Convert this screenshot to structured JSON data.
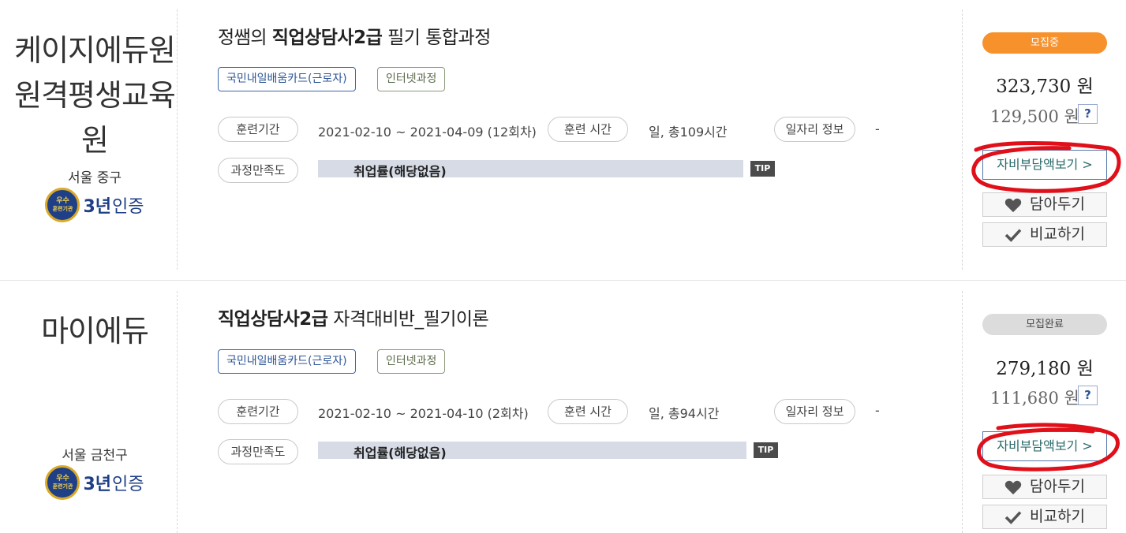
{
  "courses": [
    {
      "institution": {
        "name": "케이지에듀원 원격평생교육원",
        "location": "서울 중구",
        "cert_years": "3년",
        "cert_label": "인증",
        "seal_top": "우수",
        "seal_bottom": "훈련기관"
      },
      "title_prefix": "정쌤의 ",
      "title_bold": "직업상담사2급",
      "title_suffix": " 필기 통합과정",
      "tags": [
        "국민내일배움카드(근로자)",
        "인터넷과정"
      ],
      "period_label": "훈련기간",
      "period_value": "2021-02-10 ~ 2021-04-09 (12회차)",
      "hours_label": "훈련 시간",
      "hours_value": "일, 총109시간",
      "job_label": "일자리 정보",
      "job_value": "-",
      "satisfaction_label": "과정만족도",
      "employment_text": "취업률(해당없음)",
      "tip_label": "TIP",
      "status": "모집중",
      "price": "323,730 원",
      "self_price": "129,500 원",
      "help_label": "?",
      "self_pay_button": "자비부담액보기 >",
      "save_button": "담아두기",
      "compare_button": "비교하기"
    },
    {
      "institution": {
        "name": "마이에듀",
        "location": "서울 금천구",
        "cert_years": "3년",
        "cert_label": "인증",
        "seal_top": "우수",
        "seal_bottom": "훈련기관"
      },
      "title_prefix": "",
      "title_bold": "직업상담사2급",
      "title_suffix": " 자격대비반_필기이론",
      "tags": [
        "국민내일배움카드(근로자)",
        "인터넷과정"
      ],
      "period_label": "훈련기간",
      "period_value": "2021-02-10 ~ 2021-04-10 (2회차)",
      "hours_label": "훈련 시간",
      "hours_value": "일, 총94시간",
      "job_label": "일자리 정보",
      "job_value": "-",
      "satisfaction_label": "과정만족도",
      "employment_text": "취업률(해당없음)",
      "tip_label": "TIP",
      "status": "모집완료",
      "price": "279,180 원",
      "self_price": "111,680 원",
      "help_label": "?",
      "self_pay_button": "자비부담액보기 >",
      "save_button": "담아두기",
      "compare_button": "비교하기"
    }
  ],
  "colors": {
    "status_open": "#f7912c",
    "status_done": "#dcdcdc",
    "annotation": "#e0101a",
    "card_blue": "#3d67a8"
  },
  "icons": [
    "heart-icon",
    "check-icon",
    "seal-icon"
  ]
}
